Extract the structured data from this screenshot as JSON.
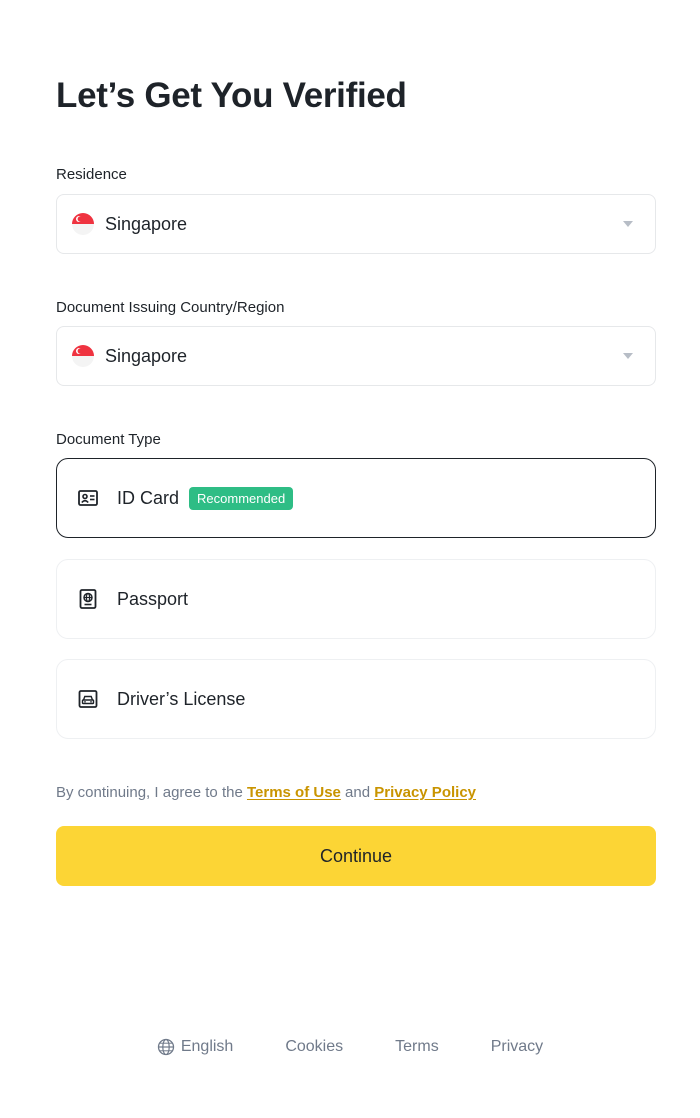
{
  "title": "Let’s Get You Verified",
  "residence": {
    "label": "Residence",
    "value": "Singapore"
  },
  "issuing_country": {
    "label": "Document Issuing Country/Region",
    "value": "Singapore"
  },
  "document_type": {
    "label": "Document Type",
    "options": [
      {
        "label": "ID Card",
        "badge": "Recommended",
        "selected": true
      },
      {
        "label": "Passport"
      },
      {
        "label": "Driver’s License"
      }
    ]
  },
  "consent": {
    "prefix": "By continuing, I agree to the ",
    "terms_link": "Terms of Use",
    "conjunction": " and ",
    "privacy_link": "Privacy Policy"
  },
  "continue_label": "Continue",
  "footer": {
    "language": "English",
    "cookies": "Cookies",
    "terms": "Terms",
    "privacy": "Privacy"
  },
  "colors": {
    "accent": "#fcd535",
    "link": "#c99400",
    "badge": "#2ebd85",
    "text": "#1e2329",
    "muted": "#707a8a"
  },
  "icons": {
    "flag": "singapore-flag-icon",
    "caret": "caret-down-icon",
    "id_card": "id-card-icon",
    "passport": "passport-icon",
    "drivers_license": "drivers-license-icon",
    "globe": "globe-icon"
  }
}
